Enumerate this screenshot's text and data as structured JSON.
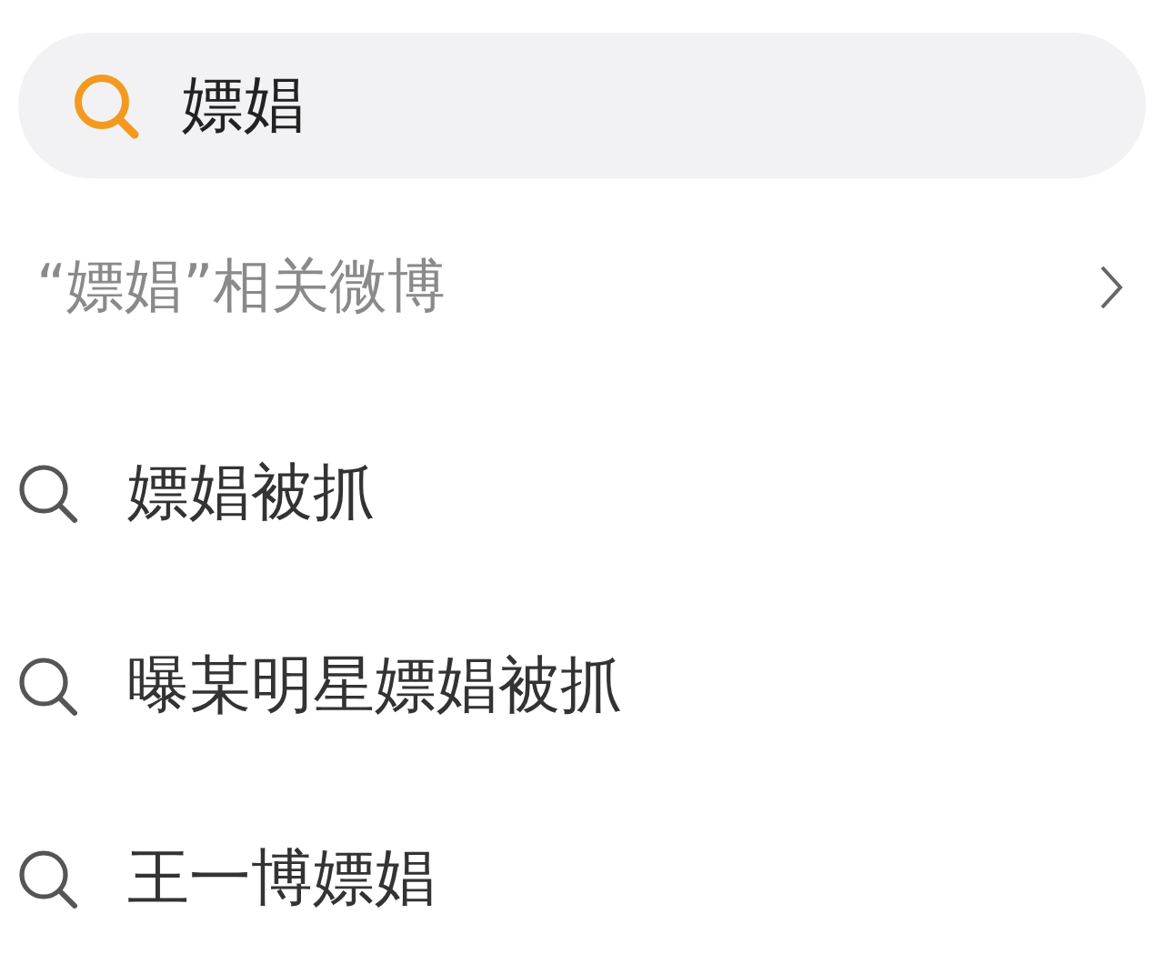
{
  "search": {
    "value": "嫖娼"
  },
  "related": {
    "label": "“嫖娼”相关微博"
  },
  "suggestions": [
    {
      "text": "嫖娼被抓"
    },
    {
      "text": "曝某明星嫖娼被抓"
    },
    {
      "text": "王一博嫖娼"
    }
  ]
}
